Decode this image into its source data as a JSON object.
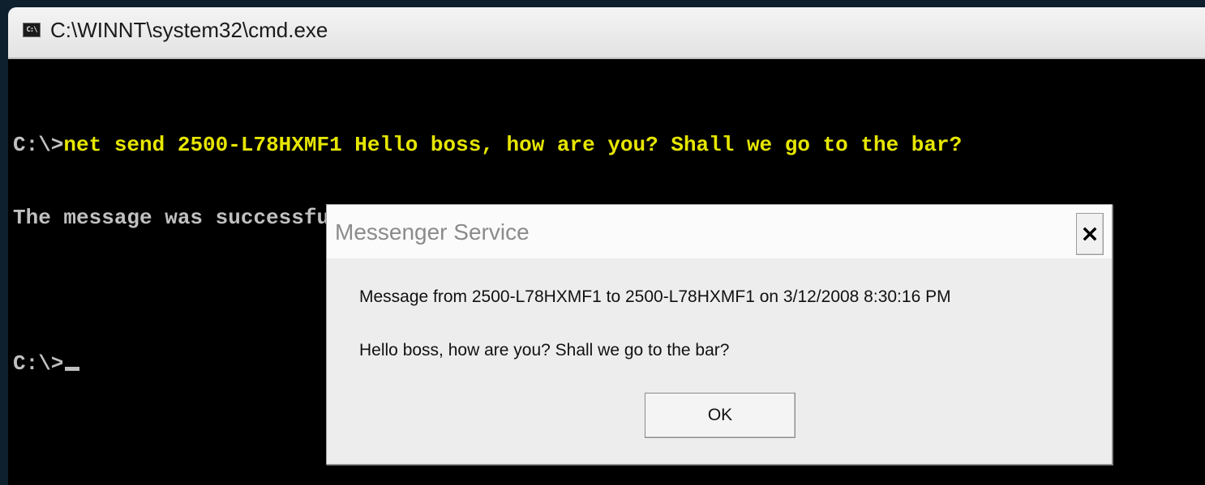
{
  "window": {
    "title": "C:\\WINNT\\system32\\cmd.exe",
    "icon_label": "C:\\"
  },
  "console": {
    "lines": [
      {
        "prompt": "C:\\>",
        "text": "net send 2500-L78HXMF1 Hello boss, how are you? Shall we go to the bar?"
      },
      {
        "prompt": "",
        "text": "The message was successfully sent to 2500-L78HXMF1."
      },
      {
        "prompt": "",
        "text": ""
      },
      {
        "prompt": "C:\\>",
        "text": ""
      }
    ]
  },
  "dialog": {
    "title": "Messenger Service",
    "from_line": "Message from 2500-L78HXMF1 to 2500-L78HXMF1 on 3/12/2008 8:30:16 PM",
    "message": "Hello boss, how are you? Shall we go to the bar?",
    "ok_label": "OK"
  },
  "colors": {
    "console_background": "#000000",
    "console_text": "#c0c0c0",
    "command_text": "#e6e600",
    "desktop_background": "#0e1f2e"
  },
  "icons": {
    "app": "cmd-icon",
    "close": "close-icon"
  }
}
